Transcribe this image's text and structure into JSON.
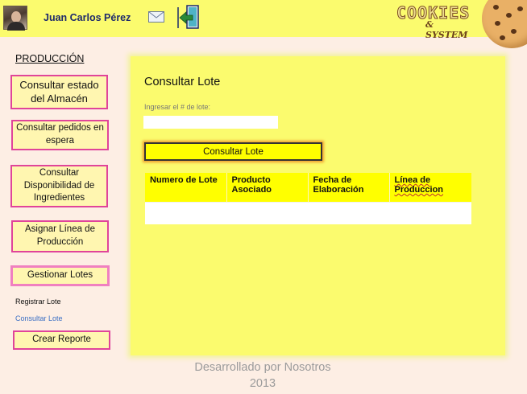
{
  "header": {
    "username": "Juan Carlos Pérez",
    "logo_main": "COOKIES",
    "logo_sub": "& SYSTEM",
    "icons": [
      "user-avatar",
      "mail-icon",
      "exit-icon",
      "cookie-logo"
    ]
  },
  "sidebar": {
    "section_title": "PRODUCCIÓN",
    "items": [
      {
        "label": "Consultar estado del Almacén"
      },
      {
        "label": "Consultar pedidos en espera"
      },
      {
        "label": "Consultar Disponibilidad de Ingredientes"
      },
      {
        "label": "Asignar Línea de Producción"
      },
      {
        "label": "Gestionar Lotes"
      }
    ],
    "sub_items": [
      {
        "label": "Registrar Lote",
        "color": "#111111"
      },
      {
        "label": "Consultar Lote",
        "color": "#3a6fc4"
      }
    ],
    "report_button": "Crear Reporte"
  },
  "main": {
    "title": "Consultar Lote",
    "input_label": "Ingresar el # de lote:",
    "input_value": "",
    "search_button": "Consultar Lote",
    "table": {
      "columns": [
        "Numero de Lote",
        "Producto Asociado",
        "Fecha de Elaboración",
        "Línea de Produccion"
      ],
      "rows": []
    }
  },
  "footer": {
    "line1": "Desarrollado por Nosotros",
    "line2": "2013"
  },
  "colors": {
    "header_bg": "#fbfb6e",
    "panel_bg": "#fbfb6e",
    "button_border": "#e0449a",
    "page_bg": "#fdeee4",
    "highlight": "#ffff00"
  }
}
